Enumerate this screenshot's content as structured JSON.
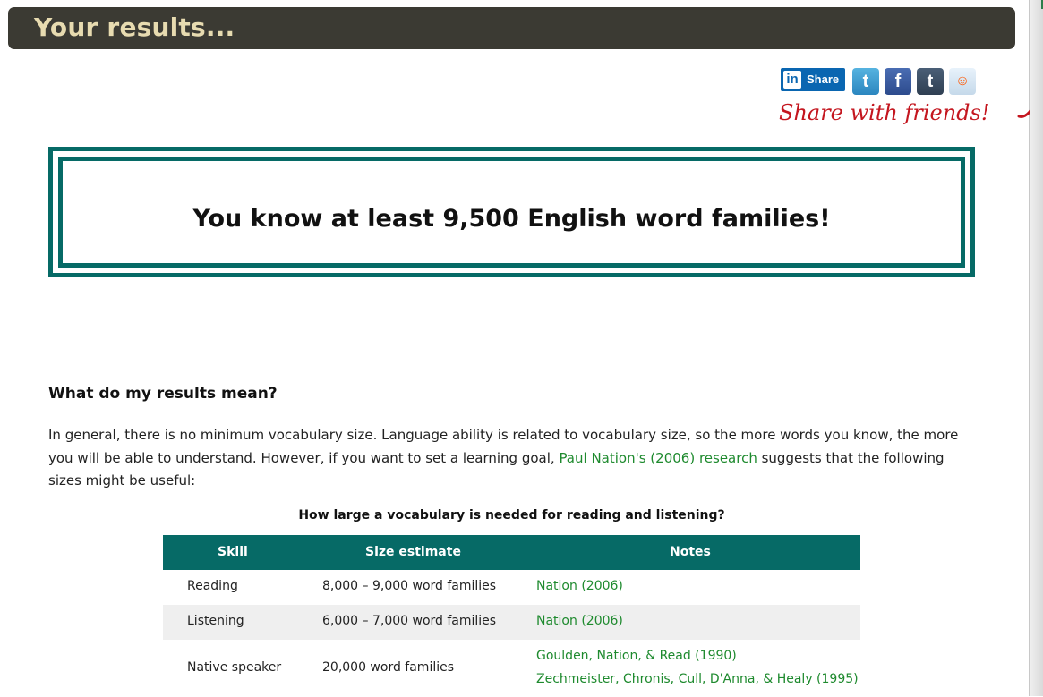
{
  "header": {
    "title": "Your results..."
  },
  "share": {
    "linkedin_label": "Share",
    "linkedin_glyph": "in",
    "twitter_glyph": "t",
    "facebook_glyph": "f",
    "tumblr_glyph": "t",
    "reddit_glyph": "☺",
    "note": "Share with friends!"
  },
  "result": {
    "message": "You know at least 9,500 English word families!"
  },
  "explanation": {
    "heading": "What do my results mean?",
    "para_before": "In general, there is no minimum vocabulary size. Language ability is related to vocabulary size, so the more words you know, the more you will be able to understand. However, if you want to set a learning goal, ",
    "link": "Paul Nation's (2006) research",
    "para_after": " suggests that the following sizes might be useful:"
  },
  "table": {
    "caption": "How large a vocabulary is needed for reading and listening?",
    "headers": {
      "skill": "Skill",
      "size": "Size estimate",
      "notes": "Notes"
    },
    "rows": [
      {
        "skill": "Reading",
        "size": "8,000 – 9,000 word families",
        "notes": [
          "Nation (2006)"
        ]
      },
      {
        "skill": "Listening",
        "size": "6,000 – 7,000 word families",
        "notes": [
          "Nation (2006)"
        ]
      },
      {
        "skill": "Native speaker",
        "size": "20,000 word families",
        "notes": [
          "Goulden, Nation, & Read (1990)",
          "Zechmeister, Chronis, Cull, D'Anna, & Healy (1995)"
        ]
      }
    ]
  },
  "colors": {
    "header_bg": "#3b3a33",
    "header_text": "#e7dbb0",
    "teal": "#066a66",
    "link": "#1e8a2e",
    "note_red": "#c4161f"
  }
}
